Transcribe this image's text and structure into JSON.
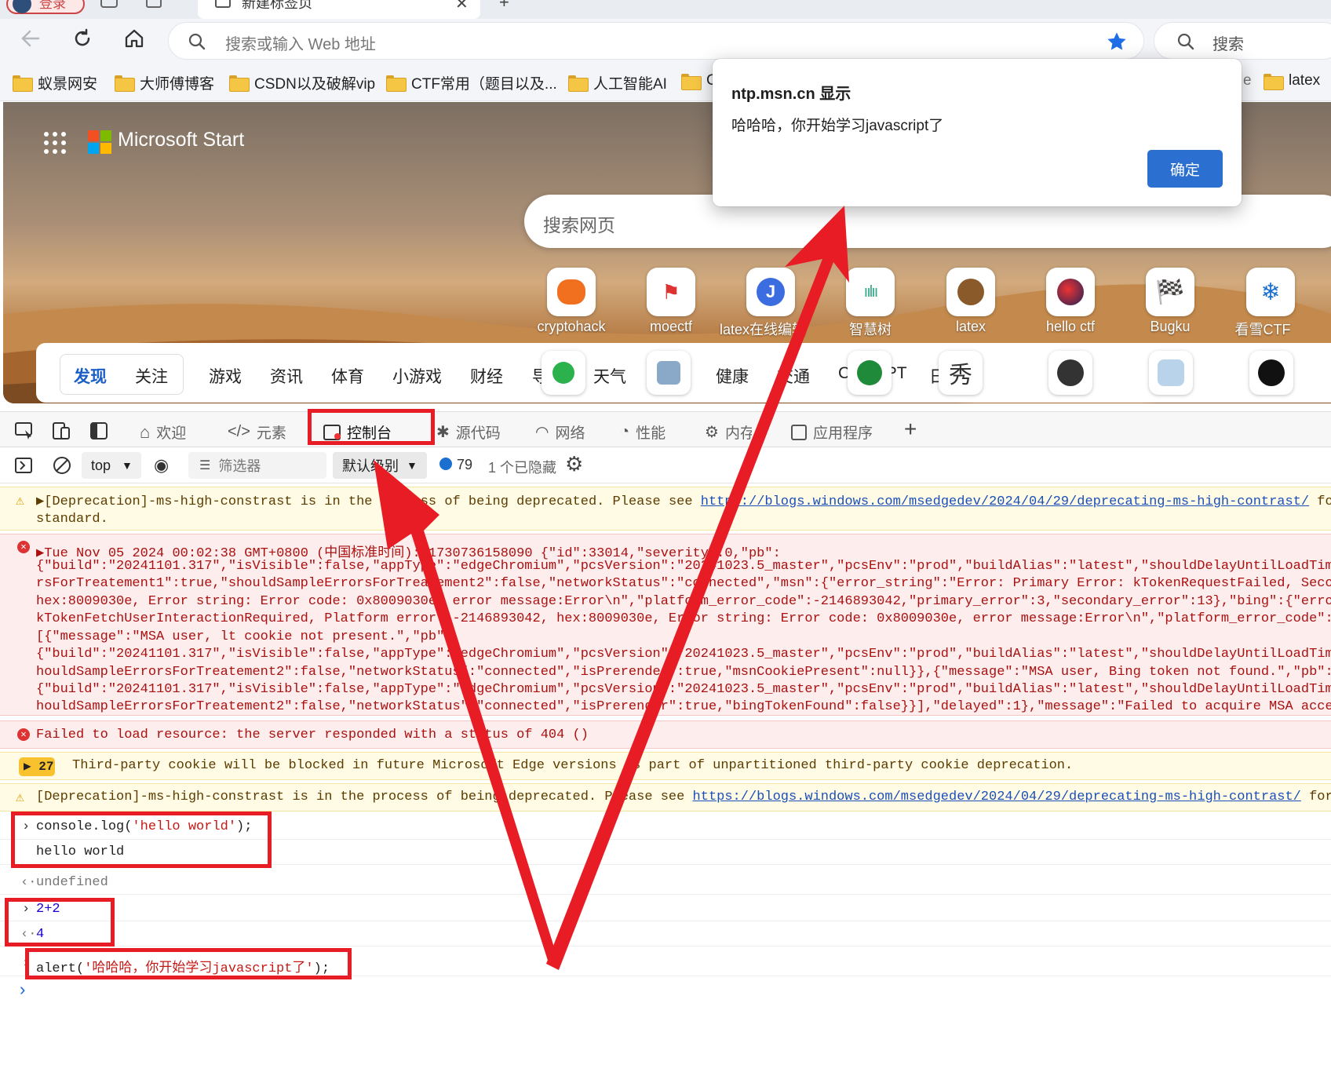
{
  "browser": {
    "login_label": "登录",
    "tab_title": "新建标签页",
    "address_placeholder": "搜索或输入 Web 地址",
    "search_label": "搜索"
  },
  "bookmarks": [
    "蚁景网安",
    "大师傅博客",
    "CSDN以及破解vip",
    "CTF常用（题目以及...",
    "人工智能AI",
    "C",
    "e",
    "latex"
  ],
  "page": {
    "brand": "Microsoft Start",
    "search_placeholder": "搜索网页",
    "tiles": [
      "cryptohack",
      "moectf",
      "latex在线编辑",
      "智慧树",
      "latex",
      "hello ctf",
      "Bugku",
      "看雪CTF"
    ],
    "categories": [
      "发现",
      "关注",
      "游戏",
      "资讯",
      "体育",
      "小游戏",
      "财经",
      "导航",
      "天气",
      "购物",
      "健康",
      "交通",
      "ChatGPT",
      "日历"
    ]
  },
  "dialog": {
    "title": "ntp.msn.cn 显示",
    "message": "哈哈哈，你开始学习javascript了",
    "ok_label": "确定"
  },
  "devtools": {
    "tabs": [
      "欢迎",
      "元素",
      "控制台",
      "源代码",
      "网络",
      "性能",
      "内存",
      "应用程序"
    ],
    "context": "top",
    "filter_placeholder": "筛选器",
    "level": "默认级别",
    "message_count": "79",
    "hidden_count": "1 个已隐藏"
  },
  "console": {
    "warn1_a": "▶[Deprecation]-ms-high-constrast is in the process of being deprecated. Please see ",
    "warn1_link": "https://blogs.windows.com/msedgedev/2024/04/29/deprecating-ms-high-contrast/",
    "warn1_b": " for tips on updating to the new Forced Colors Mode",
    "warn1_line2": "standard.",
    "err_lines": [
      "▶Tue Nov 05 2024 00:02:38 GMT+0800 (中国标准时间): 1730736158090 {\"id\":33014,\"severity\":0,\"pb\":",
      "{\"build\":\"20241101.317\",\"isVisible\":false,\"appType\":\"edgeChromium\",\"pcsVersion\":\"20241023.5_master\",\"pcsEnv\":\"prod\",\"buildAlias\":\"latest\",\"shouldDelayUntilLoadTime\":true,\"shouldSampleErro",
      "rsForTreatement1\":true,\"shouldSampleErrorsForTreatement2\":false,\"networkStatus\":\"connected\",\"msn\":{\"error_string\":\"Error: Primary Error: kTokenRequestFailed, Secondary Error:",
      "hex:8009030e, Error string: Error code: 0x8009030e, error message:Error\\n\",\"platform_error_code\":-2146893042,\"primary_error\":3,\"secondary_error\":13},\"bing\":{\"error_string\":\"Error:",
      "kTokenFetchUserInteractionRequired, Platform error: -2146893042, hex:8009030e, Error string: Error code: 0x8009030e, error message:Error\\n\",\"platform_error_code\":-2146893042,",
      "[{\"message\":\"MSA user, lt cookie not present.\",\"pb\":",
      "{\"build\":\"20241101.317\",\"isVisible\":false,\"appType\":\"edgeChromium\",\"pcsVersion\":\"20241023.5_master\",\"pcsEnv\":\"prod\",\"buildAlias\":\"latest\",\"shouldDelayUntilLoadTime\":true,\"s",
      "houldSampleErrorsForTreatement2\":false,\"networkStatus\":\"connected\",\"isPrerender\":true,\"msnCookiePresent\":null}},{\"message\":\"MSA user, Bing token not found.\",\"pb\":",
      "{\"build\":\"20241101.317\",\"isVisible\":false,\"appType\":\"edgeChromium\",\"pcsVersion\":\"20241023.5_master\",\"pcsEnv\":\"prod\",\"buildAlias\":\"latest\",\"shouldDelayUntilLoadTime\":true,\"s",
      "houldSampleErrorsForTreatement2\":false,\"networkStatus\":\"connected\",\"isPrerender\":true,\"bingTokenFound\":false}}],\"delayed\":1},\"message\":\"Failed to acquire MSA access token"
    ],
    "err2": "Failed to load resource: the server responded with a status of 404 ()",
    "cookie_count": "27",
    "cookie_msg": "Third-party cookie will be blocked in future Microsoft Edge versions as part of unpartitioned third-party cookie deprecation.",
    "warn2_a": "[Deprecation]-ms-high-constrast is in the process of being deprecated. Please see ",
    "warn2_link": "https://blogs.windows.com/msedgedev/2024/04/29/deprecating-ms-high-contrast/",
    "warn2_b": " for tips on updating",
    "in1_a": "console.log(",
    "in1_str": "'hello world'",
    "in1_b": ");",
    "out1": "hello world",
    "ret1": "undefined",
    "in2": "2+2",
    "ret2": "4",
    "in3_a": "alert(",
    "in3_str": "'哈哈哈，你开始学习javascript了'",
    "in3_b": ");"
  },
  "colors": {
    "accent": "#2b6fd0",
    "annotation_red": "#e81c24"
  }
}
